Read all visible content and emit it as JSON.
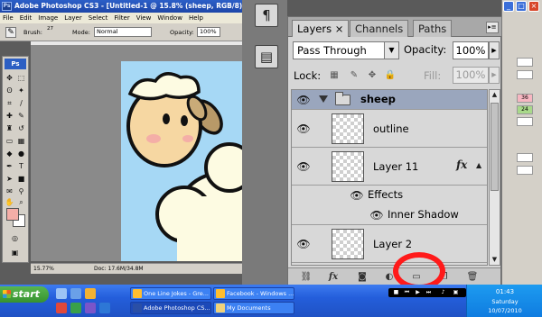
{
  "ps_window": {
    "title": "Adobe Photoshop CS3 - [Untitled-1 @ 15.8% (sheep, RGB/8)]",
    "menu": [
      "File",
      "Edit",
      "Image",
      "Layer",
      "Select",
      "Filter",
      "View",
      "Window",
      "Help"
    ],
    "options": {
      "brush_label": "Brush:",
      "brush_size": "27",
      "mode_label": "Mode:",
      "mode_value": "Normal",
      "opacity_label": "Opacity:",
      "opacity_value": "100%"
    },
    "toolbox_badge": "Ps",
    "status": {
      "zoom": "15.77%",
      "doc": "Doc: 17.6M/34.8M"
    }
  },
  "layers_panel": {
    "tabs": [
      "Layers",
      "Channels",
      "Paths"
    ],
    "tab_close": "×",
    "blend_mode": "Pass Through",
    "opacity_label": "Opacity:",
    "opacity_value": "100%",
    "lock_label": "Lock:",
    "fill_label": "Fill:",
    "fill_value": "100%",
    "layers": [
      {
        "name": "sheep",
        "type": "group"
      },
      {
        "name": "outline",
        "type": "layer"
      },
      {
        "name": "Layer 11",
        "type": "layer",
        "fx": "fx"
      },
      {
        "name": "Effects",
        "type": "effects"
      },
      {
        "name": "Inner Shadow",
        "type": "effect"
      },
      {
        "name": "Layer 2",
        "type": "layer"
      }
    ],
    "bottom_buttons": [
      "link-layers",
      "add-layer-style",
      "add-mask",
      "new-adjustment-layer",
      "new-group",
      "new-layer",
      "delete-layer"
    ]
  },
  "background_window": {
    "cells": [
      "36",
      "24"
    ]
  },
  "taskbar": {
    "start_label": "start",
    "tasks": [
      {
        "label": "One Line Jokes - Gre...",
        "active": false
      },
      {
        "label": "Facebook - Windows ...",
        "active": false
      },
      {
        "label": "Adobe Photoshop CS...",
        "active": true
      },
      {
        "label": "My Documents",
        "active": false
      }
    ],
    "tray": {
      "time": "01:43",
      "day": "Saturday",
      "date": "10/07/2010"
    }
  },
  "colors": {
    "foreground": "#f4aea7",
    "canvas_bg": "#a6d8f5",
    "highlight_circle": "#ff1a1a",
    "group_row": "#9aa6bd"
  }
}
